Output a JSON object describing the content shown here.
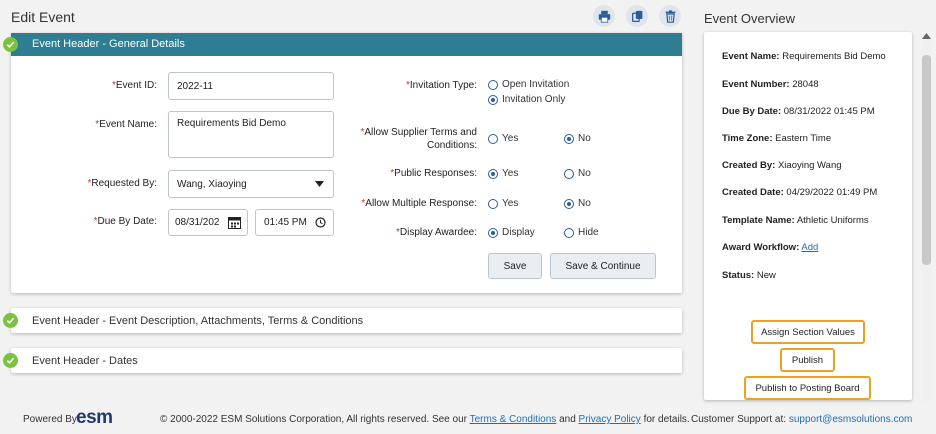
{
  "page": {
    "title": "Edit Event"
  },
  "toolbar": {
    "print_icon": "print-icon",
    "copy_icon": "copy-icon",
    "delete_icon": "trash-icon"
  },
  "general": {
    "header": "Event Header - General Details",
    "event_id_label": "Event ID:",
    "event_id_value": "2022-11",
    "event_name_label": "Event Name:",
    "event_name_value": "Requirements Bid Demo",
    "requested_by_label": "Requested By:",
    "requested_by_value": "Wang, Xiaoying",
    "due_by_label": "Due By Date:",
    "due_date_value": "08/31/202",
    "due_time_value": "01:45 PM",
    "invitation_label": "Invitation Type:",
    "invitation_options": [
      "Open Invitation",
      "Invitation Only"
    ],
    "supplier_terms_label_1": "Allow Supplier Terms and",
    "supplier_terms_label_2": "Conditions:",
    "public_label": "Public Responses:",
    "multiple_label": "Allow Multiple Response:",
    "awardee_label": "Display Awardee:",
    "yes": "Yes",
    "no": "No",
    "display": "Display",
    "hide": "Hide",
    "save": "Save",
    "save_continue": "Save & Continue",
    "required_mark": "*"
  },
  "sections": [
    "Event Header - Event Description, Attachments, Terms & Conditions",
    "Event Header - Dates"
  ],
  "overview": {
    "title": "Event Overview",
    "items": [
      {
        "label": "Event Name:",
        "value": "Requirements Bid Demo"
      },
      {
        "label": "Event Number:",
        "value": "28048"
      },
      {
        "label": "Due By Date:",
        "value": "08/31/2022 01:45 PM"
      },
      {
        "label": "Time Zone:",
        "value": "Eastern Time"
      },
      {
        "label": "Created By:",
        "value": "Xiaoying Wang"
      },
      {
        "label": "Created Date:",
        "value": "04/29/2022 01:49 PM"
      },
      {
        "label": "Template Name:",
        "value": "Athletic Uniforms"
      },
      {
        "label": "Award Workflow:",
        "value": "Add"
      },
      {
        "label": "Status:",
        "value": "New"
      }
    ],
    "assign": "Assign Section Values",
    "publish": "Publish",
    "posting": "Publish to Posting Board"
  },
  "footer": {
    "powered": "Powered By:",
    "logo": "esm",
    "copyright": "© 2000-2022 ESM Solutions Corporation, All rights reserved. See our",
    "terms": "Terms & Conditions",
    "and": "and",
    "privacy": "Privacy Policy",
    "details": "for details.",
    "support": "Customer Support at:",
    "email": "support@esmsolutions.com"
  }
}
